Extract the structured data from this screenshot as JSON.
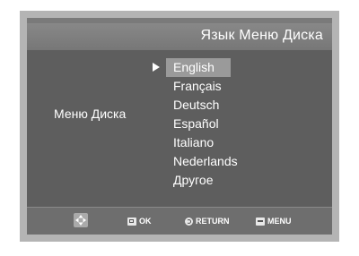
{
  "header": {
    "title": "Язык Меню Диска"
  },
  "section": {
    "label": "Меню Диска"
  },
  "options": [
    {
      "label": "English",
      "selected": true
    },
    {
      "label": "Français",
      "selected": false
    },
    {
      "label": "Deutsch",
      "selected": false
    },
    {
      "label": "Español",
      "selected": false
    },
    {
      "label": "Italiano",
      "selected": false
    },
    {
      "label": "Nederlands",
      "selected": false
    },
    {
      "label": "Другое",
      "selected": false
    }
  ],
  "footer": {
    "ok_label": "OK",
    "return_label": "RETURN",
    "menu_label": "MENU",
    "icons": [
      "nav-pad-icon",
      "ok-icon",
      "return-icon",
      "menu-icon"
    ]
  },
  "colors": {
    "screen_bg": "#5e5e5e",
    "title_bar": "#808080",
    "highlight": "#9a9a9a",
    "frame": "#b4b4b4",
    "text": "#ffffff"
  }
}
